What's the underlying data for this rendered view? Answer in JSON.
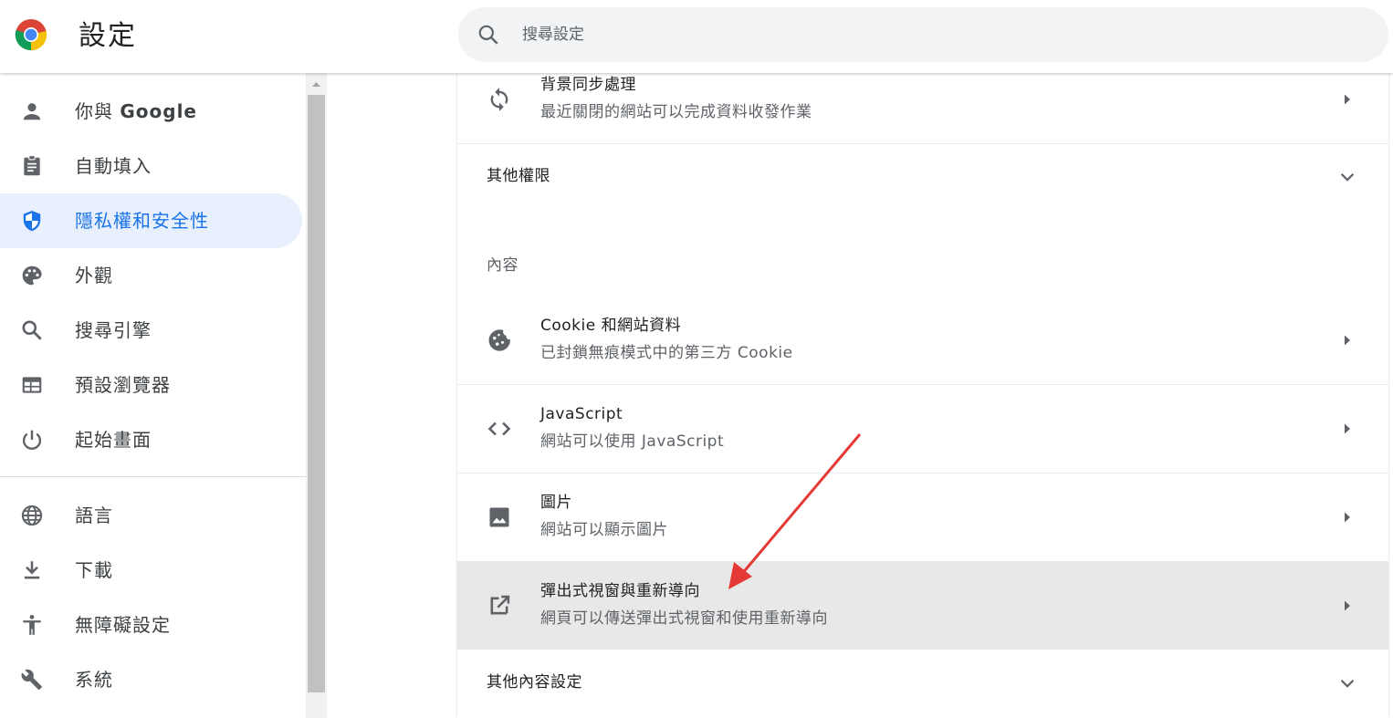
{
  "header": {
    "title": "設定",
    "search_placeholder": "搜尋設定",
    "search_value": ""
  },
  "sidebar": {
    "items": [
      {
        "label_prefix": "你與 ",
        "label_bold": "Google",
        "icon": "person-icon"
      },
      {
        "label": "自動填入",
        "icon": "clipboard-icon"
      },
      {
        "label": "隱私權和安全性",
        "icon": "shield-icon",
        "active": true
      },
      {
        "label": "外觀",
        "icon": "palette-icon"
      },
      {
        "label": "搜尋引擎",
        "icon": "search-icon"
      },
      {
        "label": "預設瀏覽器",
        "icon": "browser-icon"
      },
      {
        "label": "起始畫面",
        "icon": "power-icon"
      },
      {
        "label": "語言",
        "icon": "globe-icon"
      },
      {
        "label": "下載",
        "icon": "download-icon"
      },
      {
        "label": "無障礙設定",
        "icon": "accessibility-icon"
      },
      {
        "label": "系統",
        "icon": "wrench-icon"
      }
    ]
  },
  "main": {
    "background_sync": {
      "title": "背景同步處理",
      "subtitle": "最近關閉的網站可以完成資料收發作業"
    },
    "more_permissions": "其他權限",
    "content_section": "內容",
    "rows": [
      {
        "title": "Cookie 和網站資料",
        "subtitle": "已封鎖無痕模式中的第三方 Cookie",
        "icon": "cookie-icon"
      },
      {
        "title": "JavaScript",
        "subtitle": "網站可以使用 JavaScript",
        "icon": "code-icon"
      },
      {
        "title": "圖片",
        "subtitle": "網站可以顯示圖片",
        "icon": "image-icon"
      },
      {
        "title": "彈出式視窗與重新導向",
        "subtitle": "網頁可以傳送彈出式視窗和使用重新導向",
        "icon": "open-in-new-icon",
        "highlighted": true
      }
    ],
    "more_content_settings": "其他內容設定"
  },
  "colors": {
    "accent": "#1a73e8",
    "active_bg": "#e8f0fe",
    "highlight_row": "#e8e8e8",
    "annotation_arrow": "#e53935"
  }
}
